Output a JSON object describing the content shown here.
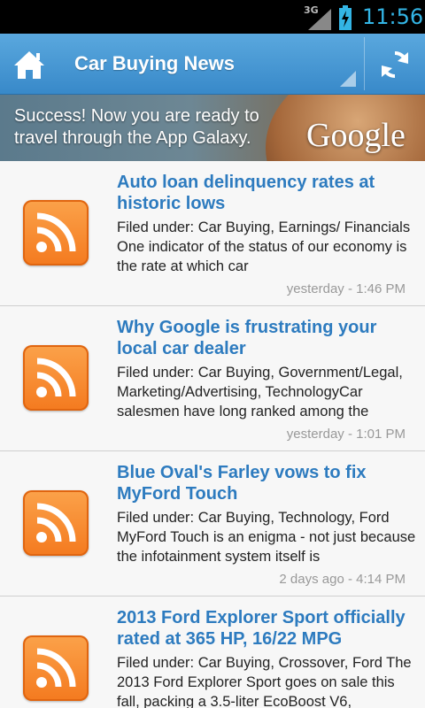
{
  "status_bar": {
    "network": "3G",
    "time": "11:56"
  },
  "action_bar": {
    "title": "Car Buying News",
    "home_icon": "home-icon",
    "refresh_icon": "refresh-icon"
  },
  "ad": {
    "text": "Success! Now you are ready to travel through the App Galaxy.",
    "logo": "Google"
  },
  "feed": {
    "items": [
      {
        "title": "Auto loan delinquency rates at historic lows",
        "summary": "Filed under: Car Buying, Earnings/ Financials One indicator of the status of our economy is the rate at which car",
        "time": "yesterday - 1:46 PM"
      },
      {
        "title": "Why Google is frustrating your local car dealer",
        "summary": "Filed under: Car Buying, Government/Legal, Marketing/Advertising, TechnologyCar salesmen have long ranked among the",
        "time": "yesterday - 1:01 PM"
      },
      {
        "title": "Blue Oval's Farley vows to fix MyFord Touch",
        "summary": "Filed under: Car Buying, Technology, Ford MyFord Touch is an enigma - not just because the infotainment system itself is",
        "time": "2 days ago - 4:14 PM"
      },
      {
        "title": "2013 Ford Explorer Sport officially rated at 365 HP, 16/22 MPG",
        "summary": "Filed under: Car Buying, Crossover, Ford The 2013 Ford Explorer Sport goes on sale this fall, packing a 3.5-liter EcoBoost V6,",
        "time": ""
      }
    ]
  },
  "colors": {
    "action_bar": "#3e90cf",
    "title_link": "#2d7bbf",
    "rss_orange": "#f47a1f",
    "status_accent": "#33b5e5"
  }
}
